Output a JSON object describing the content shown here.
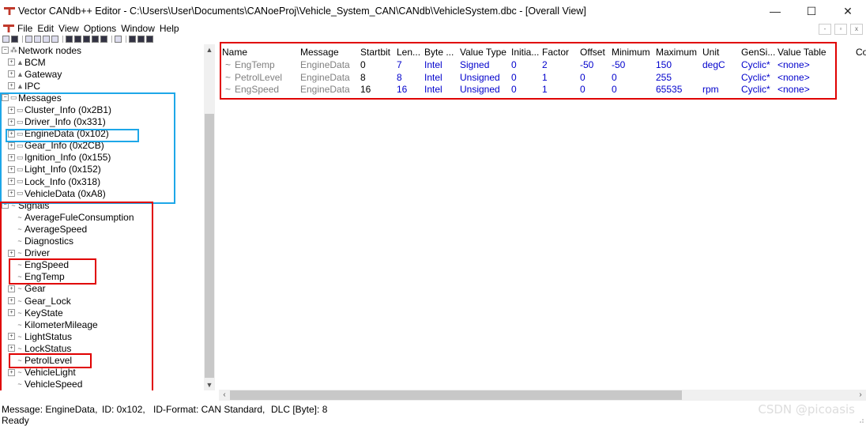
{
  "window": {
    "title": "Vector CANdb++ Editor - C:\\Users\\User\\Documents\\CANoeProj\\Vehicle_System_CAN\\CANdb\\VehicleSystem.dbc - [Overall View]",
    "minimize": "—",
    "maximize": "☐",
    "close": "✕"
  },
  "menu": [
    "File",
    "Edit",
    "View",
    "Options",
    "Window",
    "Help"
  ],
  "tree": {
    "network_nodes": {
      "label": "Network nodes",
      "items": [
        "BCM",
        "Gateway",
        "IPC"
      ]
    },
    "messages": {
      "label": "Messages",
      "items": [
        "Cluster_Info (0x2B1)",
        "Driver_Info (0x331)",
        "EngineData (0x102)",
        "Gear_Info (0x2CB)",
        "Ignition_Info (0x155)",
        "Light_Info (0x152)",
        "Lock_Info (0x318)",
        "VehicleData (0xA8)"
      ]
    },
    "signals": {
      "label": "Signals",
      "items": [
        {
          "name": "AverageFuleConsumption",
          "expandable": false
        },
        {
          "name": "AverageSpeed",
          "expandable": false
        },
        {
          "name": "Diagnostics",
          "expandable": false
        },
        {
          "name": "Driver",
          "expandable": true
        },
        {
          "name": "EngSpeed",
          "expandable": false
        },
        {
          "name": "EngTemp",
          "expandable": false
        },
        {
          "name": "Gear",
          "expandable": true
        },
        {
          "name": "Gear_Lock",
          "expandable": true
        },
        {
          "name": "KeyState",
          "expandable": true
        },
        {
          "name": "KilometerMileage",
          "expandable": false
        },
        {
          "name": "LightStatus",
          "expandable": true
        },
        {
          "name": "LockStatus",
          "expandable": true
        },
        {
          "name": "PetrolLevel",
          "expandable": false
        },
        {
          "name": "VehicleLight",
          "expandable": true
        },
        {
          "name": "VehicleSpeed",
          "expandable": false
        }
      ]
    }
  },
  "grid": {
    "columns": [
      "Name",
      "Message",
      "Startbit",
      "Len...",
      "Byte ...",
      "Value Type",
      "Initia...",
      "Factor",
      "Offset",
      "Minimum",
      "Maximum",
      "Unit",
      "GenSi...",
      "Value Table",
      "Co"
    ],
    "rows": [
      [
        "EngTemp",
        "EngineData",
        "0",
        "7",
        "Intel",
        "Signed",
        "0",
        "2",
        "-50",
        "-50",
        "150",
        "degC",
        "Cyclic*",
        "<none>"
      ],
      [
        "PetrolLevel",
        "EngineData",
        "8",
        "8",
        "Intel",
        "Unsigned",
        "0",
        "1",
        "0",
        "0",
        "255",
        "",
        "Cyclic*",
        "<none>"
      ],
      [
        "EngSpeed",
        "EngineData",
        "16",
        "16",
        "Intel",
        "Unsigned",
        "0",
        "1",
        "0",
        "0",
        "65535",
        "rpm",
        "Cyclic*",
        "<none>"
      ]
    ]
  },
  "status": {
    "message": "Message: EngineData,",
    "id": "ID: 0x102,",
    "format": "ID-Format: CAN Standard,",
    "dlc": "DLC [Byte]: 8",
    "ready": "Ready"
  },
  "watermark": "CSDN @picoasis",
  "colors": {
    "highlight_red": "#e00000",
    "highlight_blue": "#1ea7e8",
    "value_blue": "#0000cc",
    "muted_gray": "#808080"
  }
}
